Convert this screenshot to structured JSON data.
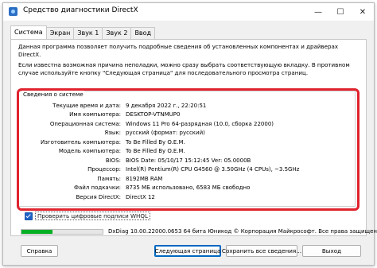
{
  "window": {
    "title": "Средство диагностики DirectX",
    "controls": {
      "minimize": "—",
      "maximize": "☐",
      "close": "✕"
    }
  },
  "tabs": [
    "Система",
    "Экран",
    "Звук 1",
    "Звук 2",
    "Ввод"
  ],
  "active_tab": "Система",
  "intro": {
    "line1": "Данная программа позволяет получить подробные сведения об установленных компонентах и драйверах DirectX.",
    "line2": "Если известна возможная причина неполадки, можно сразу выбрать соответствующую вкладку. В противном случае используйте кнопку \"Следующая страница\" для последовательного просмотра страниц."
  },
  "system_info": {
    "title": "Сведения о системе",
    "rows": [
      {
        "label": "Текущие время и дата:",
        "value": "9 декабря 2022 г., 22:20:51"
      },
      {
        "label": "Имя компьютера:",
        "value": "DESKTOP-VTNMUP0"
      },
      {
        "label": "Операционная система:",
        "value": "Windows 11 Pro 64-разрядная (10.0, сборка 22000)"
      },
      {
        "label": "Язык:",
        "value": "русский (формат: русский)"
      },
      {
        "label": "Изготовитель компьютера:",
        "value": "To Be Filled By O.E.M."
      },
      {
        "label": "Модель компьютера:",
        "value": "To Be Filled By O.E.M."
      },
      {
        "label": "BIOS:",
        "value": "BIOS Date: 05/10/17 15:12:45 Ver: 05.0000B"
      },
      {
        "label": "Процессор:",
        "value": "Intel(R) Pentium(R) CPU G4560 @ 3.50GHz (4 CPUs), ~3.5GHz"
      },
      {
        "label": "Память:",
        "value": "8192MB RAM"
      },
      {
        "label": "Файл подкачки:",
        "value": "8735 МБ использовано, 6583 МБ свободно"
      },
      {
        "label": "Версия DirectX:",
        "value": "DirectX 12"
      }
    ]
  },
  "whql_checkbox": {
    "label": "Проверить цифровые подписи WHQL",
    "checked": true
  },
  "progress": {
    "fraction": 0.38,
    "color": "#06b025"
  },
  "status": "DxDiag 10.00.22000.0653 64 бита Юникод © Корпорация Майкрософт. Все права защищены.",
  "buttons": {
    "help": "Справка",
    "next": "Следующая страница",
    "save": "Сохранить все сведения...",
    "exit": "Выход"
  },
  "highlight_color": "#e0232e"
}
